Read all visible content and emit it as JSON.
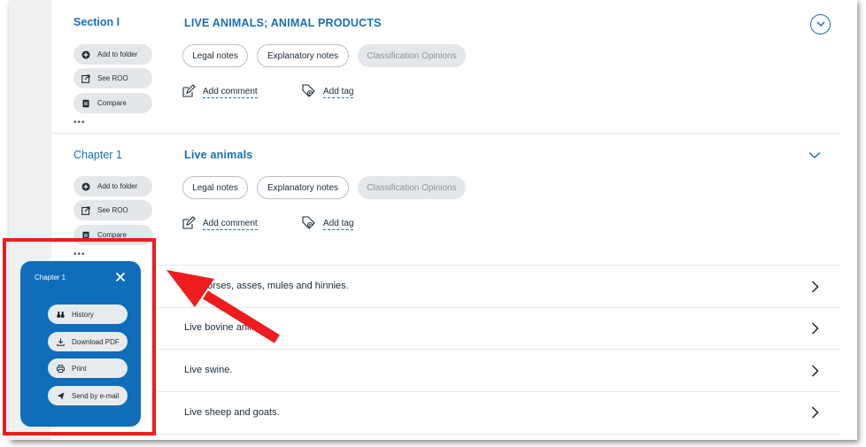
{
  "section": {
    "label": "Section I",
    "title": "LIVE ANIMALS; ANIMAL PRODUCTS",
    "actions": [
      "Add to folder",
      "See ROO",
      "Compare"
    ],
    "buttons": [
      "Legal notes",
      "Explanatory notes",
      "Classification Opinions"
    ],
    "add_comment": "Add comment",
    "add_tag": "Add tag"
  },
  "chapter": {
    "label": "Chapter 1",
    "title": "Live animals",
    "actions": [
      "Add to folder",
      "See ROO",
      "Compare"
    ],
    "buttons": [
      "Legal notes",
      "Explanatory notes",
      "Classification Opinions"
    ],
    "add_comment": "Add comment",
    "add_tag": "Add tag"
  },
  "rows": [
    "horses, asses, mules and hinnies.",
    "Live bovine anim",
    "Live swine.",
    "Live sheep and goats."
  ],
  "popup": {
    "title": "Chapter 1",
    "items": [
      "History",
      "Download PDF",
      "Print",
      "Send by e-mail"
    ]
  },
  "colors": {
    "accent": "#1a6fb5",
    "popup_bg": "#0f6dba",
    "highlight": "#ee1c1c"
  }
}
